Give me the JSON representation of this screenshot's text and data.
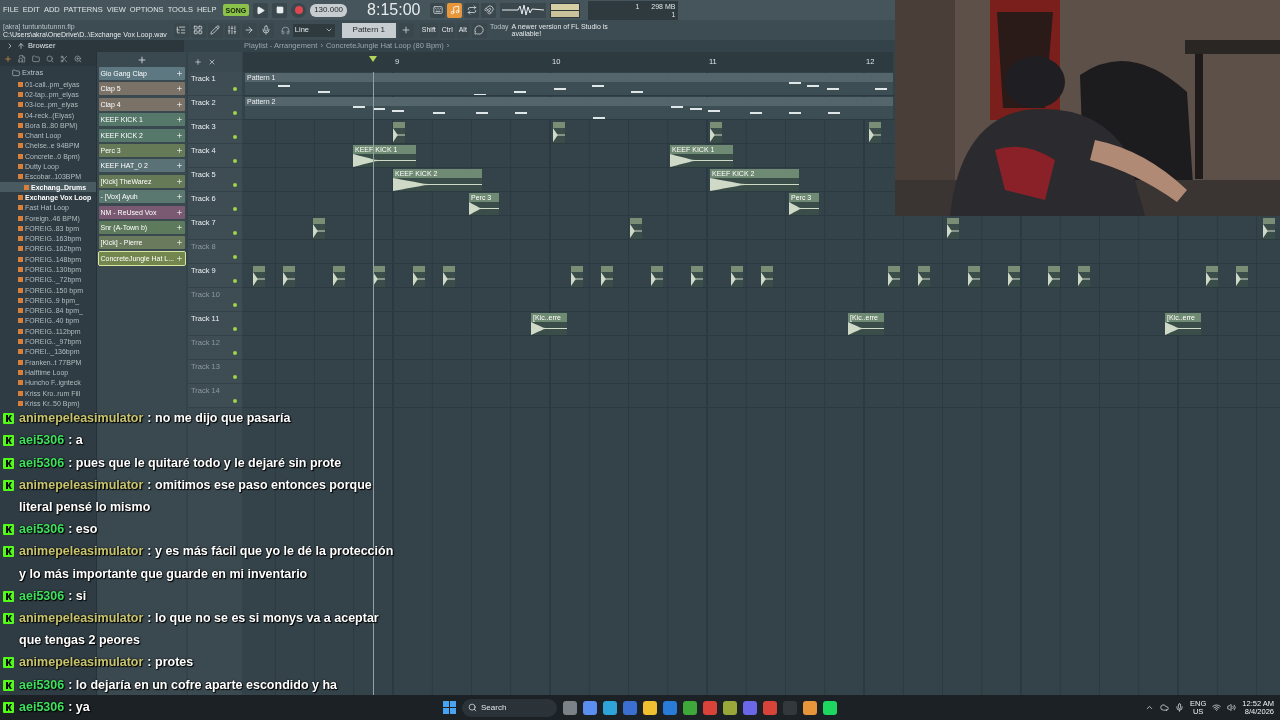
{
  "menu": [
    "FILE",
    "EDIT",
    "ADD",
    "PATTERNS",
    "VIEW",
    "OPTIONS",
    "TOOLS",
    "HELP"
  ],
  "transport": {
    "mode": "SONG",
    "song_mode": true,
    "tempo": "130.000",
    "time": "8:15:00"
  },
  "monitor": {
    "pattern_number": "1",
    "memory": "298 MB",
    "cpu": "1"
  },
  "file": {
    "title": "[akra] tuntuntutunnn.flp",
    "path": "C:\\Users\\akra\\OneDrive\\D..\\Exchange Vox Loop.wav"
  },
  "toolbar": {
    "input": "Line",
    "pattern": "Pattern 1",
    "keys": [
      "Shift",
      "Ctrl",
      "Alt"
    ],
    "notice_day": "Today",
    "notice": "A newer version of FL Studio is available!"
  },
  "browser": {
    "title": "Browser",
    "folder": "Extras",
    "items": [
      {
        "name": "01-call..pm_elyas",
        "selected": false,
        "hovered": false
      },
      {
        "name": "02-tap..pm_elyas",
        "selected": false,
        "hovered": false
      },
      {
        "name": "03-ice..pm_elyas",
        "selected": false,
        "hovered": false
      },
      {
        "name": "04-reck..(Elyas)",
        "selected": false,
        "hovered": false
      },
      {
        "name": "Bora B..80 BPM)",
        "selected": false,
        "hovered": false
      },
      {
        "name": "Chant Loop",
        "selected": false,
        "hovered": false
      },
      {
        "name": "Chelse..e 94BPM",
        "selected": false,
        "hovered": false
      },
      {
        "name": "Concrete..0 Bpm)",
        "selected": false,
        "hovered": false
      },
      {
        "name": "Dutty Loop",
        "selected": false,
        "hovered": false
      },
      {
        "name": "Escobar..103BPM",
        "selected": false,
        "hovered": false
      },
      {
        "name": "Exchang..Drums",
        "selected": true,
        "hovered": false
      },
      {
        "name": "Exchange Vox Loop",
        "selected": false,
        "hovered": true
      },
      {
        "name": "Fast Hat Loop",
        "selected": false,
        "hovered": false
      },
      {
        "name": "Foreign..46 BPM)",
        "selected": false,
        "hovered": false
      },
      {
        "name": "FOREIG..83 bpm",
        "selected": false,
        "hovered": false
      },
      {
        "name": "FOREIG..163bpm",
        "selected": false,
        "hovered": false
      },
      {
        "name": "FOREIG..162bpm",
        "selected": false,
        "hovered": false
      },
      {
        "name": "FOREIG..148bpm",
        "selected": false,
        "hovered": false
      },
      {
        "name": "FOREIG..130bpm",
        "selected": false,
        "hovered": false
      },
      {
        "name": "FOREIG.._72bpm",
        "selected": false,
        "hovered": false
      },
      {
        "name": "FOREIG..150 bpm",
        "selected": false,
        "hovered": false
      },
      {
        "name": "FOREIG..9 bpm_",
        "selected": false,
        "hovered": false
      },
      {
        "name": "FOREIG..84 bpm_",
        "selected": false,
        "hovered": false
      },
      {
        "name": "FOREIG..40 bpm",
        "selected": false,
        "hovered": false
      },
      {
        "name": "FOREIG..112bpm",
        "selected": false,
        "hovered": false
      },
      {
        "name": "FOREIG.._97bpm",
        "selected": false,
        "hovered": false
      },
      {
        "name": "FOREI.._136bpm",
        "selected": false,
        "hovered": false
      },
      {
        "name": "Franken..t 77BPM",
        "selected": false,
        "hovered": false
      },
      {
        "name": "Halftime Loop",
        "selected": false,
        "hovered": false
      },
      {
        "name": "Huncho F..ignteck",
        "selected": false,
        "hovered": false
      },
      {
        "name": "Kriss Kro..rum Fill",
        "selected": false,
        "hovered": false
      },
      {
        "name": "Kriss Kr..50 Bpm)",
        "selected": false,
        "hovered": false
      }
    ]
  },
  "channels": [
    {
      "name": "Gio Gang Clap",
      "color": "#5d7880",
      "selected": false
    },
    {
      "name": "Clap 5",
      "color": "#7a7267",
      "selected": false
    },
    {
      "name": "Clap 4",
      "color": "#7a7267",
      "selected": false
    },
    {
      "name": "KEEF KICK 1",
      "color": "#56786a",
      "selected": false
    },
    {
      "name": "KEEF KICK 2",
      "color": "#56786a",
      "selected": false
    },
    {
      "name": "Perc 3",
      "color": "#667a58",
      "selected": false
    },
    {
      "name": "KEEF HAT_0 2",
      "color": "#5a7276",
      "selected": false
    },
    {
      "name": "[Kick] TheWarez",
      "color": "#667a58",
      "selected": false
    },
    {
      "name": "- [Vox] Ayuh",
      "color": "#5a7870",
      "selected": false
    },
    {
      "name": "NM - ReUsed Vox",
      "color": "#7a5a72",
      "selected": false
    },
    {
      "name": "Snr (A-Town b)",
      "color": "#5e7a5c",
      "selected": false
    },
    {
      "name": "[Kick] - Pierre",
      "color": "#6a7a5c",
      "selected": false
    },
    {
      "name": "ConcreteJungle Hat L...",
      "color": "#73864e",
      "selected": true
    }
  ],
  "playlist": {
    "breadcrumb": [
      "Playlist - Arrangement",
      "›",
      "ConcreteJungle Hat Loop (80 Bpm)",
      "›"
    ],
    "bars": [
      "9",
      "10",
      "11",
      "12"
    ],
    "tracks": [
      {
        "name": "Track 1",
        "muted": false,
        "clips": [
          {
            "kind": "pattern",
            "label": "Pattern 1"
          }
        ]
      },
      {
        "name": "Track 2",
        "muted": false,
        "clips": [
          {
            "kind": "pattern",
            "label": "Pattern 2"
          }
        ]
      },
      {
        "name": "Track 3",
        "muted": false,
        "clips": [
          {
            "kind": "stub"
          },
          {
            "kind": "stub"
          },
          {
            "kind": "stub"
          },
          {
            "kind": "stub"
          }
        ]
      },
      {
        "name": "Track 4",
        "muted": false,
        "clips": [
          {
            "kind": "audio",
            "label": "KEEF KICK 1"
          },
          {
            "kind": "audio",
            "label": "KEEF KICK 1"
          }
        ]
      },
      {
        "name": "Track 5",
        "muted": false,
        "clips": [
          {
            "kind": "audio",
            "label": "KEEF KICK 2"
          },
          {
            "kind": "audio",
            "label": "KEEF KICK 2"
          }
        ]
      },
      {
        "name": "Track 6",
        "muted": false,
        "clips": [
          {
            "kind": "audio",
            "label": "Perc 3"
          },
          {
            "kind": "audio",
            "label": "Perc 3"
          }
        ]
      },
      {
        "name": "Track 7",
        "muted": false,
        "clips": [
          {
            "kind": "stub"
          },
          {
            "kind": "stub"
          },
          {
            "kind": "stub"
          },
          {
            "kind": "stub"
          }
        ]
      },
      {
        "name": "Track 8",
        "muted": true
      },
      {
        "name": "Track 9",
        "muted": false,
        "clips": [
          {
            "kind": "stub"
          },
          {
            "kind": "stub"
          },
          {
            "kind": "stub"
          },
          {
            "kind": "stub"
          },
          {
            "kind": "stub"
          },
          {
            "kind": "stub"
          },
          {
            "kind": "stub"
          },
          {
            "kind": "stub"
          },
          {
            "kind": "stub"
          },
          {
            "kind": "stub"
          },
          {
            "kind": "stub"
          },
          {
            "kind": "stub"
          },
          {
            "kind": "stub"
          },
          {
            "kind": "stub"
          },
          {
            "kind": "stub"
          },
          {
            "kind": "stub"
          },
          {
            "kind": "stub"
          },
          {
            "kind": "stub"
          },
          {
            "kind": "stub"
          },
          {
            "kind": "stub"
          }
        ]
      },
      {
        "name": "Track 10",
        "muted": true
      },
      {
        "name": "Track 11",
        "muted": false,
        "clips": [
          {
            "kind": "audio",
            "label": "[Kic..erre"
          },
          {
            "kind": "audio",
            "label": "[Kic..erre"
          },
          {
            "kind": "audio",
            "label": "[Kic..erre"
          }
        ]
      },
      {
        "name": "Track 12",
        "muted": true
      },
      {
        "name": "Track 13",
        "muted": true
      },
      {
        "name": "Track 14",
        "muted": true
      }
    ]
  },
  "chat": [
    {
      "user": "animepeleasimulator",
      "color": "#c9c46e",
      "text": ": no me dijo que pasaría"
    },
    {
      "user": "aei5306",
      "color": "#3fe05e",
      "text": ": a"
    },
    {
      "user": "aei5306",
      "color": "#3fe05e",
      "text": ": pues que le quitaré todo y le dejaré sin prote"
    },
    {
      "user": "animepeleasimulator",
      "color": "#c9c46e",
      "text": ": omitimos ese paso entonces porque literal pensé lo mismo"
    },
    {
      "user": "aei5306",
      "color": "#3fe05e",
      "text": ": eso"
    },
    {
      "user": "animepeleasimulator",
      "color": "#c9c46e",
      "text": ": y es más fácil que yo le dé la protección y lo más importante que guarde en mi inventario"
    },
    {
      "user": "aei5306",
      "color": "#3fe05e",
      "text": ": si"
    },
    {
      "user": "animepeleasimulator",
      "color": "#c9c46e",
      "text": ": lo que no se es si monys va a aceptar que tengas 2 peores"
    },
    {
      "user": "animepeleasimulator",
      "color": "#c9c46e",
      "text": ": protes"
    },
    {
      "user": "aei5306",
      "color": "#3fe05e",
      "text": ": lo dejaría en un cofre aparte escondido y ha"
    },
    {
      "user": "aei5306",
      "color": "#3fe05e",
      "text": ": ya"
    }
  ],
  "taskbar": {
    "search": "Search",
    "language": "ENG",
    "region": "US",
    "time": "12:52 AM",
    "date": "8/4/2026"
  }
}
